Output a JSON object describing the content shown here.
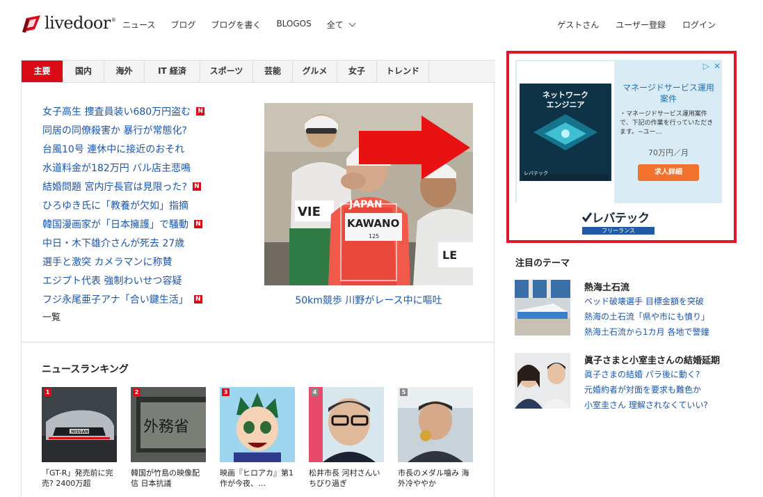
{
  "header": {
    "logo_text": "livedoor",
    "logo_reg": "®",
    "nav": [
      "ニュース",
      "ブログ",
      "ブログを書く",
      "BLOGOS",
      "全て"
    ],
    "user_nav": [
      "ゲストさん",
      "ユーザー登録",
      "ログイン"
    ]
  },
  "tabs": [
    "主要",
    "国内",
    "海外",
    "IT 経済",
    "スポーツ",
    "芸能",
    "グルメ",
    "女子",
    "トレンド"
  ],
  "headlines": [
    {
      "text": "女子高生 捜査員装い680万円盗む",
      "new": true
    },
    {
      "text": "同居の同僚殺害か 暴行が常態化?",
      "new": false
    },
    {
      "text": "台風10号 連休中に接近のおそれ",
      "new": false
    },
    {
      "text": "水道料金が182万円 バル店主悲鳴",
      "new": false
    },
    {
      "text": "結婚問題 宮内庁長官は見限った?",
      "new": true
    },
    {
      "text": "ひろゆき氏に「教養が欠如」指摘",
      "new": false
    },
    {
      "text": "韓国漫画家が「日本擁護」で騒動",
      "new": true
    },
    {
      "text": "中日・木下雄介さんが死去 27歳",
      "new": false
    },
    {
      "text": "選手と激突 カメラマンに称賛",
      "new": false
    },
    {
      "text": "エジプト代表 強制わいせつ容疑",
      "new": false
    },
    {
      "text": "フジ永尾亜子アナ「合い鍵生活」",
      "new": true
    }
  ],
  "new_badge": "N",
  "more_link": "一覧",
  "feature": {
    "caption": "50km競歩 川野がレース中に嘔吐",
    "bib_left": "VIE",
    "bib_center": "JAPAN",
    "bib_name": "KAWANO",
    "bib_no": "125",
    "bib_right": "LE"
  },
  "ranking": {
    "title": "ニュースランキング",
    "items": [
      {
        "num": "1",
        "text": "「GT-R」発売前に完売? 2400万超",
        "img_text": "NISSAN",
        "top": true
      },
      {
        "num": "2",
        "text": "韓国が竹島の映像配信 日本抗議",
        "img_text": "外務省",
        "top": true
      },
      {
        "num": "3",
        "text": "映画『ヒロアカ』第1作が今夜、…",
        "img_text": "",
        "top": true
      },
      {
        "num": "4",
        "text": "松井市長 河村さんいちびり過ぎ",
        "img_text": "",
        "top": false
      },
      {
        "num": "5",
        "text": "市長のメダル噛み 海外冷ややか",
        "img_text": "",
        "top": false
      }
    ]
  },
  "ad": {
    "card_title": "ネットワーク\nエンジニア",
    "card_brand": "レバテック",
    "title": "マネージドサービス運用案件",
    "body": "・マネージドサービス運用案件で、下記の作業を行っていただきます。−ユー…",
    "price": "70万円／月",
    "button": "求人詳細",
    "brand_name": "レバテック",
    "brand_sub": "フリーランス",
    "adchoices_label": "▷",
    "close_label": "✕"
  },
  "themes": {
    "title": "注目のテーマ",
    "items": [
      {
        "head": "熱海土石流",
        "links": [
          "ベッド破壊選手 目標金額を突破",
          "熱海の土石流「県や市にも憤り」",
          "熱海土石流から1カ月 各地で警鐘"
        ]
      },
      {
        "head": "眞子さまと小室圭さんの結婚延期",
        "links": [
          "眞子さまの結婚 パラ後に動く?",
          "元婚約者が対面を要求も難色か",
          "小室圭さん 理解されなくていい?"
        ]
      }
    ]
  },
  "colors": {
    "accent": "#d90b17",
    "link": "#1a55b0",
    "ad_border": "#e0162b"
  }
}
